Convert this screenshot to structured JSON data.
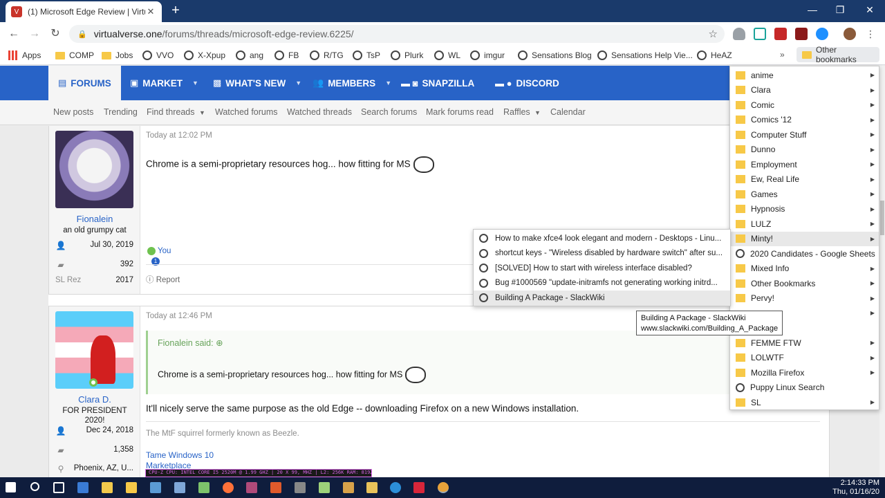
{
  "browser": {
    "tab_title": "(1) Microsoft Edge Review | Virtu",
    "tab_close": "✕",
    "new_tab": "+",
    "win_min": "—",
    "win_max": "❐",
    "win_close": "✕",
    "url_host": "virtualverse.one",
    "url_path": "/forums/threads/microsoft-edge-review.6225/"
  },
  "bookmarks_bar": {
    "items": [
      "Apps",
      "COMP",
      "Jobs",
      "VVO",
      "X-Xpup",
      "ang",
      "FB",
      "R/TG",
      "TsP",
      "Plurk",
      "WL",
      "imgur",
      "Sensations Blog",
      "Sensations Help Vie...",
      "HeAZ"
    ],
    "overflow": "»",
    "other": "Other bookmarks"
  },
  "site_nav": {
    "tabs": [
      "FORUMS",
      "MARKET",
      "WHAT'S NEW",
      "MEMBERS",
      "SNAPZILLA",
      "DISCORD"
    ],
    "sub": [
      "New posts",
      "Trending",
      "Find threads",
      "Watched forums",
      "Watched threads",
      "Search forums",
      "Mark forums read",
      "Raffles",
      "Calendar"
    ]
  },
  "posts": [
    {
      "username": "Fionalein",
      "user_title": "an old grumpy cat",
      "joined": "Jul 30, 2019",
      "messages": "392",
      "sl_rez_label": "SL Rez",
      "sl_rez": "2017",
      "time": "Today at 12:02 PM",
      "body": "Chrome is a semi-proprietary resources hog... how fitting for MS",
      "reaction_user": "You",
      "reaction_count": "1",
      "report": "Report"
    },
    {
      "username": "Clara D.",
      "user_title": "FOR PRESIDENT 2020!",
      "joined": "Dec 24, 2018",
      "messages": "1,358",
      "location": "Phoenix, AZ, U...",
      "time": "Today at 12:46 PM",
      "quote_author": "Fionalein said: ⊕",
      "quote_body": "Chrome is a semi-proprietary resources hog... how fitting for MS",
      "body": "It'll nicely serve the same purpose as the old Edge -- downloading Firefox on a new Windows installation.",
      "signature": "The MtF squirrel formerly known as Beezle.",
      "sig_link1": "Tame Windows 10",
      "sig_link2": "Marketplace",
      "cpuz": "CPU-Z CPU: INTEL CORE I5 2520M @ 1.99 GHZ | 20 X 99, MHZ | L2: 256K RAM: 8192 MB DDR3-SDRAM @ 663.6MHZ (9-9-9-24) | SK HYNIX"
    }
  ],
  "bookmark_menu": [
    "anime",
    "Clara",
    "Comic",
    "Comics '12",
    "Computer Stuff",
    "Dunno",
    "Employment",
    "Ew, Real Life",
    "Games",
    "Hypnosis",
    "LULZ",
    "Minty!",
    "2020 Candidates - Google Sheets",
    "Mixed Info",
    "Other Bookmarks",
    "Pervy!",
    "",
    "FEMME FTW",
    "LOLWTF",
    "Mozilla Firefox",
    "Puppy Linux Search",
    "SL"
  ],
  "submenu": [
    "How to make xfce4 look elegant and modern - Desktops - Linu...",
    "shortcut keys - \"Wireless disabled by hardware switch\" after su...",
    "[SOLVED] How to start with wireless interface disabled?",
    "Bug #1000569 \"update-initramfs not generating working initrd...",
    "Building A Package - SlackWiki"
  ],
  "tooltip": {
    "title": "Building A Package - SlackWiki",
    "url": "www.slackwiki.com/Building_A_Package"
  },
  "clock": {
    "time": "2:14:33 PM",
    "date": "Thu, 01/16/20"
  },
  "colors": {
    "accent": "#2863c7",
    "titlebar": "#1a3a6b",
    "taskbar": "#0f1d3d"
  }
}
